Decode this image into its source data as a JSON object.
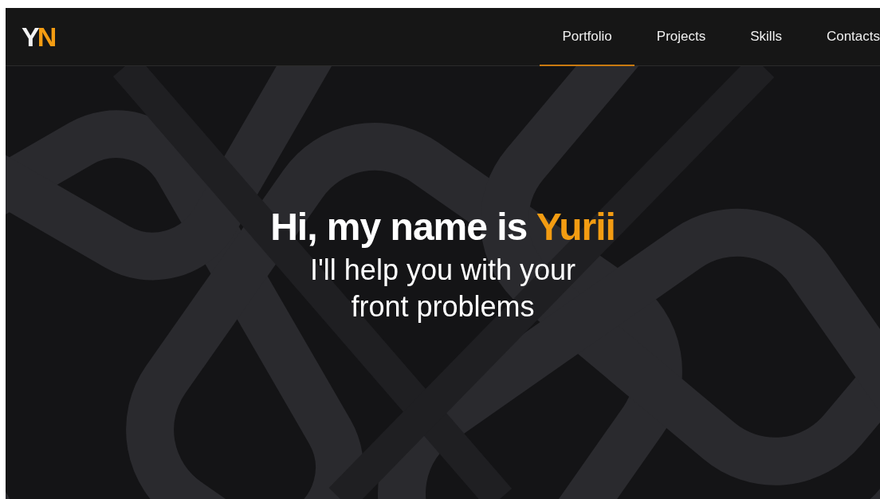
{
  "logo": {
    "first": "Y",
    "second": "N"
  },
  "nav": [
    {
      "label": "Portfolio",
      "selected": true
    },
    {
      "label": "Projects",
      "selected": false
    },
    {
      "label": "Skills",
      "selected": false
    },
    {
      "label": "Contacts",
      "selected": false
    }
  ],
  "hero": {
    "greeting": "Hi, my name is",
    "name": "Yurii",
    "subtitle": "I'll help you with your front problems"
  }
}
